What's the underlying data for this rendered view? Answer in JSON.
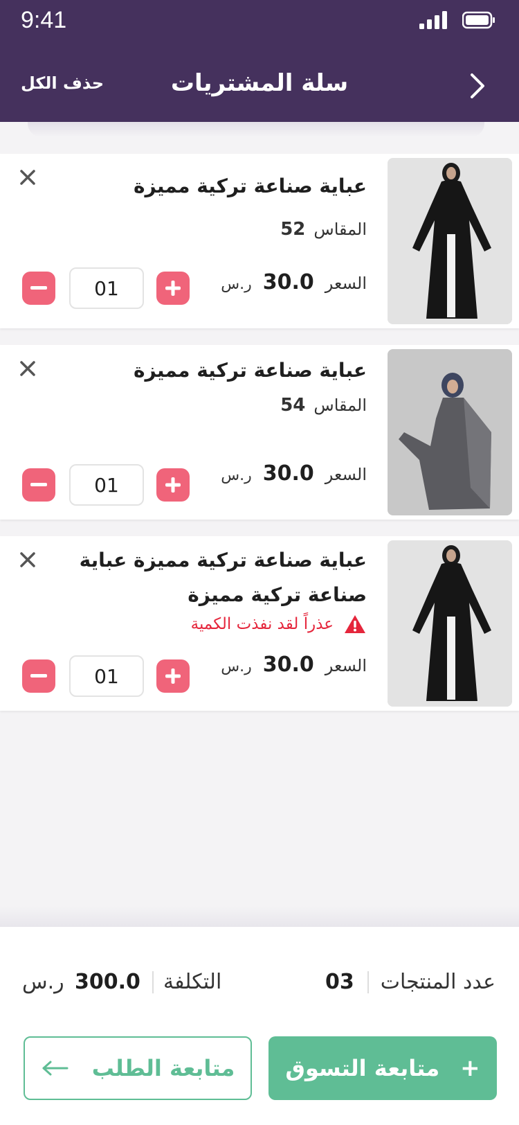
{
  "status_bar": {
    "time": "9:41"
  },
  "header": {
    "title": "سلة المشتريات",
    "delete_all": "حذف الكل",
    "back_icon": "chevron-right-icon"
  },
  "colors": {
    "header_bg": "#45315d",
    "accent_green": "#5fbd95",
    "qty_button": "#f0647a",
    "warning": "#e5263c"
  },
  "items": [
    {
      "name": "عباية صناعة تركية مميزة",
      "size_label": "المقاس",
      "size": "52",
      "price_label": "السعر",
      "price": "30.0",
      "currency": "ر.س",
      "quantity": "01",
      "image": "black-abaya"
    },
    {
      "name": "عباية صناعة تركية مميزة",
      "size_label": "المقاس",
      "size": "54",
      "price_label": "السعر",
      "price": "30.0",
      "currency": "ر.س",
      "quantity": "01",
      "image": "grey-abaya"
    },
    {
      "name": "عباية صناعة تركية مميزة عباية صناعة تركية مميزة",
      "warning": "عذراً لقد نفذت الكمية",
      "price_label": "السعر",
      "price": "30.0",
      "currency": "ر.س",
      "quantity": "01",
      "image": "black-abaya"
    }
  ],
  "summary": {
    "count_label": "عدد المنتجات",
    "count": "03",
    "cost_label": "التكلفة",
    "cost": "300.0",
    "currency": "ر.س"
  },
  "buttons": {
    "continue_shopping": "متابعة التسوق",
    "checkout": "متابعة الطلب"
  }
}
